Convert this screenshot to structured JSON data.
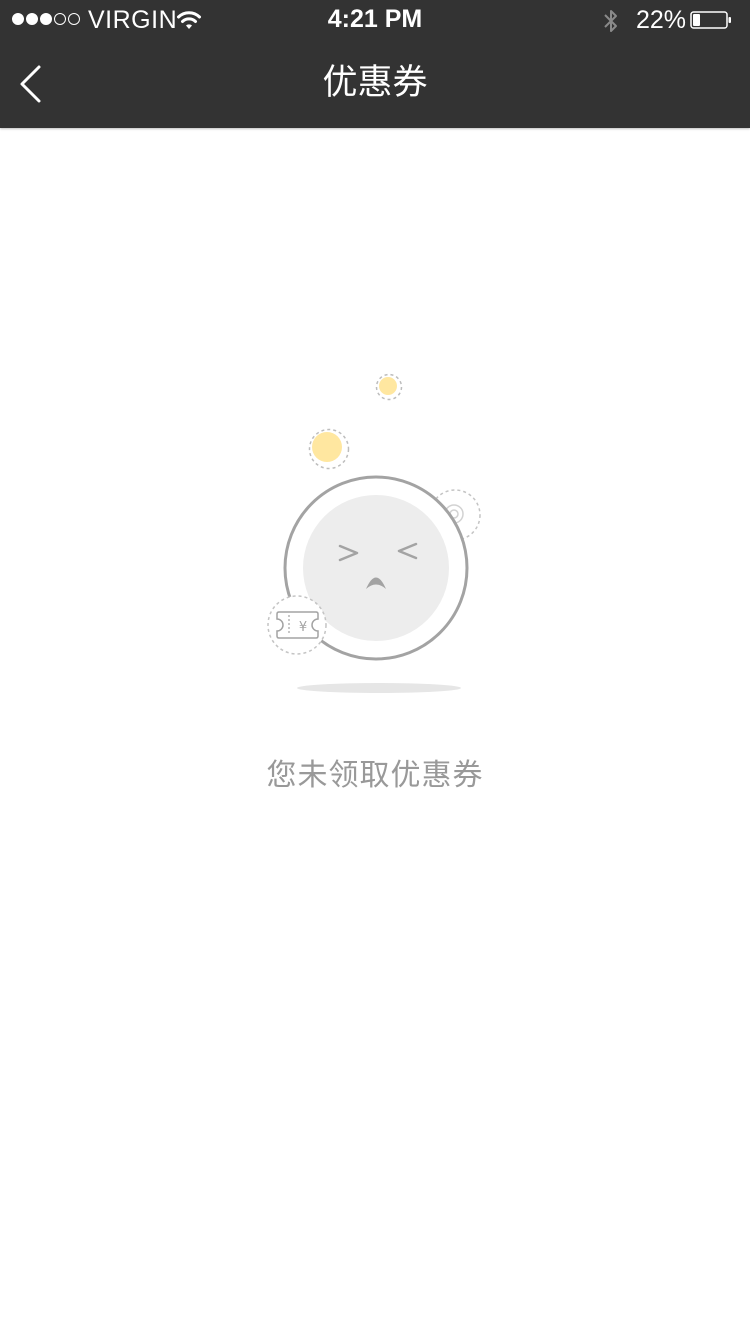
{
  "status_bar": {
    "carrier": "VIRGIN",
    "time": "4:21 PM",
    "battery_percent": "22%",
    "signal_bars_filled": 3,
    "signal_bars_total": 5
  },
  "nav": {
    "title": "优惠券"
  },
  "empty_state": {
    "message": "您未领取优惠券",
    "coupon_symbol": "¥"
  },
  "colors": {
    "header_bg": "#333333",
    "accent_yellow": "#FFE7A0",
    "illustration_gray": "#A3A3A3",
    "face_fill": "#EDEDED",
    "message_text": "#999999"
  }
}
